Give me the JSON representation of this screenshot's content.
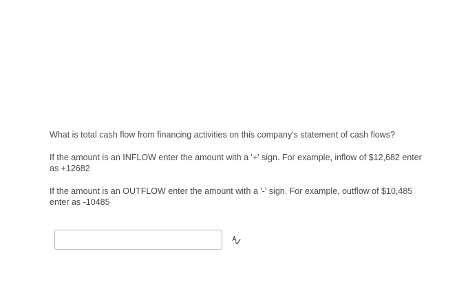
{
  "question": {
    "prompt": "What is total cash flow from financing activities on this company's statement of cash flows?",
    "inflow_instruction": "If the amount is an INFLOW enter the amount with a '+' sign.  For example, inflow of $12,682 enter as +12682",
    "outflow_instruction": "If the amount is an OUTFLOW enter the amount with a '-' sign.  For example, outflow of $10,485 enter as -10485"
  },
  "answer": {
    "value": "",
    "placeholder": ""
  },
  "icons": {
    "spell_check": "spell-check-icon"
  }
}
